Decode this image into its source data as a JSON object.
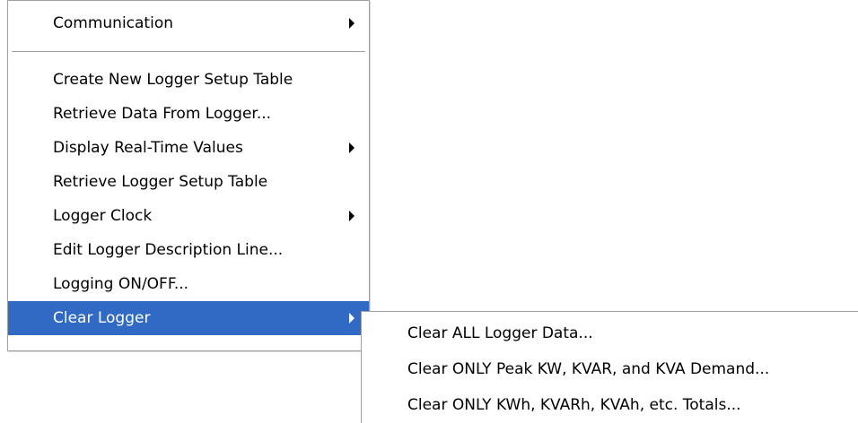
{
  "main_menu": {
    "items": [
      {
        "label": "Communication",
        "submenu": true
      },
      {
        "label": "Create New Logger Setup Table",
        "submenu": false
      },
      {
        "label": "Retrieve Data From Logger...",
        "submenu": false
      },
      {
        "label": "Display Real-Time Values",
        "submenu": true
      },
      {
        "label": "Retrieve Logger Setup Table",
        "submenu": false
      },
      {
        "label": "Logger Clock",
        "submenu": true
      },
      {
        "label": "Edit Logger Description Line...",
        "submenu": false
      },
      {
        "label": "Logging ON/OFF...",
        "submenu": false
      },
      {
        "label": "Clear Logger",
        "submenu": true,
        "highlighted": true
      }
    ]
  },
  "sub_menu": {
    "items": [
      {
        "label": "Clear ALL Logger Data..."
      },
      {
        "label": "Clear ONLY Peak KW, KVAR, and KVA Demand..."
      },
      {
        "label": "Clear ONLY KWh, KVARh, KVAh, etc. Totals..."
      }
    ]
  },
  "colors": {
    "highlight_background": "#316ac5",
    "highlight_text": "#ffffff",
    "menu_border": "#a0a0a0"
  },
  "icons": {
    "submenu_arrow": "chevron-right-icon"
  }
}
